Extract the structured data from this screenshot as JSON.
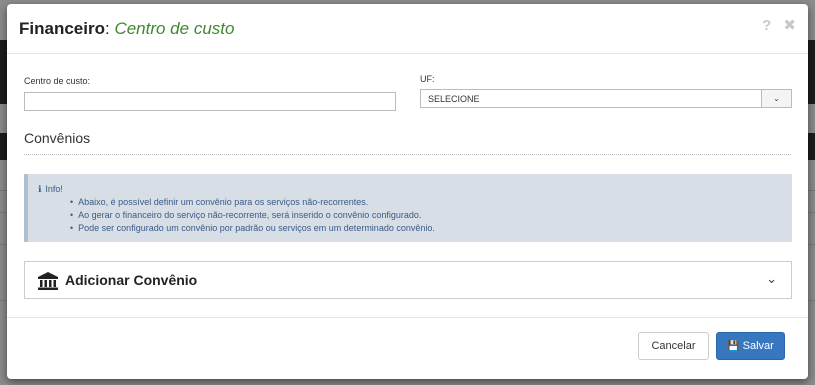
{
  "background": {
    "partial_text": "...."
  },
  "modal": {
    "title_main": "Financeiro",
    "title_sep": ":",
    "title_sub": "Centro de custo",
    "help_icon": "?",
    "close_icon": "✖"
  },
  "form": {
    "centro_label": "Centro de custo:",
    "centro_value": "",
    "uf_label": "UF:",
    "uf_selected": "SELECIONE"
  },
  "convenios": {
    "section_title": "Convênios",
    "info_title": "Info!",
    "info_items": [
      "Abaixo, é possível definir um convênio para os serviços não-recorrentes.",
      "Ao gerar o financeiro do serviço não-recorrente, será inserido o convênio configurado.",
      "Pode ser configurado um convênio por padrão ou serviços em um determinado convênio."
    ],
    "add_label": "Adicionar Convênio",
    "add_icon": "bank-icon"
  },
  "footer": {
    "cancel_label": "Cancelar",
    "save_label": "Salvar",
    "save_icon": "floppy-disk-icon"
  },
  "colors": {
    "accent_green": "#3c8a2e",
    "primary_blue": "#3777c0",
    "info_bg": "#d8dee6",
    "info_text": "#3a5a86"
  }
}
